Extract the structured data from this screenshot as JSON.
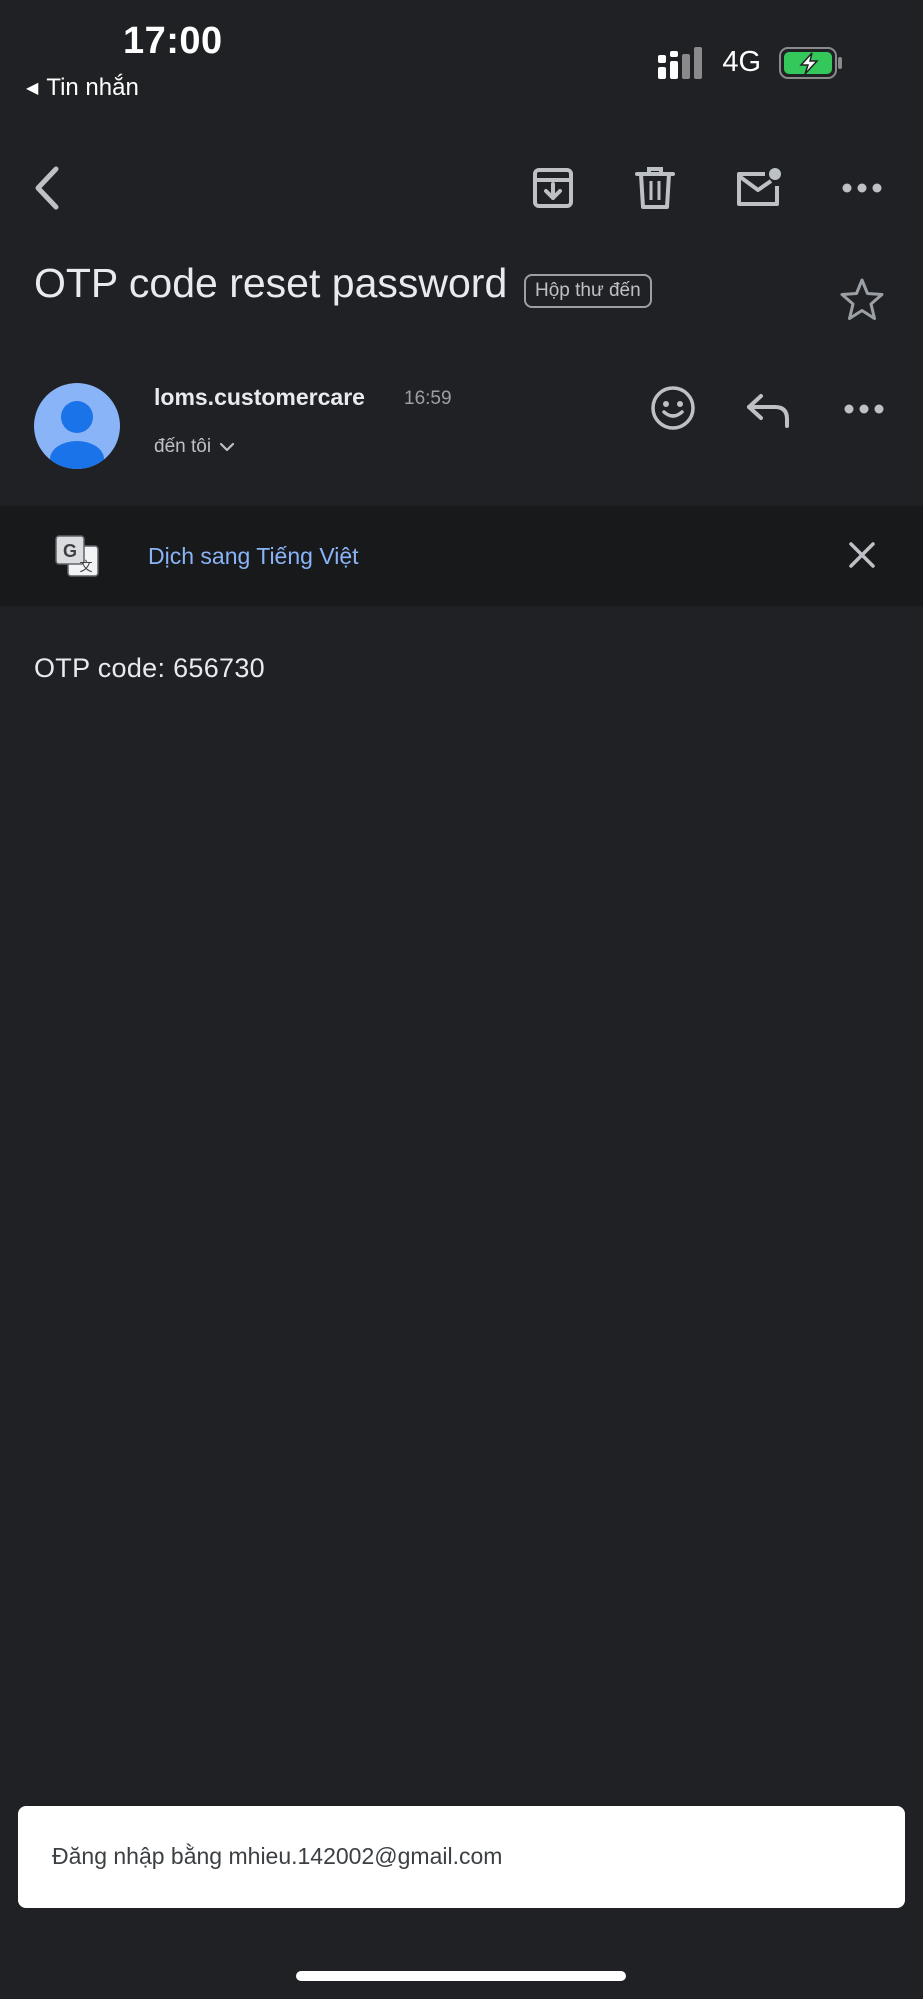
{
  "status_bar": {
    "time": "17:00",
    "back_label": "Tin nhắn",
    "network": "4G"
  },
  "toolbar": {
    "icons": [
      "back-arrow-icon",
      "archive-icon",
      "trash-icon",
      "mark-unread-icon",
      "more-icon"
    ]
  },
  "email": {
    "subject": "OTP code reset password",
    "label": "Hộp thư đến",
    "sender": "loms.customercare",
    "time": "16:59",
    "recipient": "đến tôi",
    "body": "OTP code: 656730"
  },
  "translate": {
    "label": "Dịch sang Tiếng Việt"
  },
  "account": {
    "signed_in_text": "Đăng nhập bằng mhieu.142002@gmail.com"
  },
  "colors": {
    "background": "#202124",
    "accent_link": "#8ab4f8",
    "battery_green": "#34c759"
  }
}
